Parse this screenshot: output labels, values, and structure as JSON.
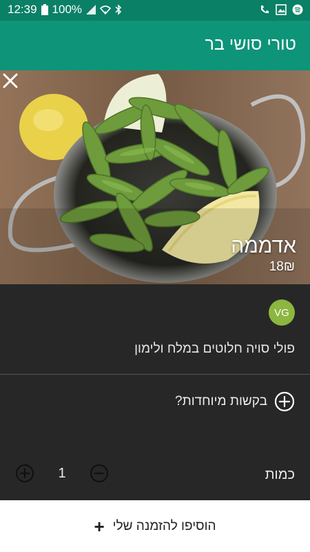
{
  "status_bar": {
    "time": "12:39",
    "battery": "100%",
    "icons": [
      "battery-icon",
      "signal-icon",
      "wifi-icon",
      "bluetooth-icon",
      "call-icon",
      "image-icon",
      "spotify-icon"
    ]
  },
  "app_bar": {
    "title": "טורי סושי בר"
  },
  "item": {
    "name": "אדממה",
    "price": "18₪",
    "badge": "VG",
    "description": "פולי סויה חלוטים במלח ולימון"
  },
  "special_requests": {
    "label": "בקשות מיוחדות?"
  },
  "quantity": {
    "label": "כמות",
    "value": "1"
  },
  "bottom": {
    "add_label": "הוסיפו להזמנה שלי",
    "add_icon": "+"
  },
  "colors": {
    "status_bar": "#0a8066",
    "app_bar": "#0e9479",
    "panel_bg": "#272727",
    "badge": "#8bb63f"
  }
}
